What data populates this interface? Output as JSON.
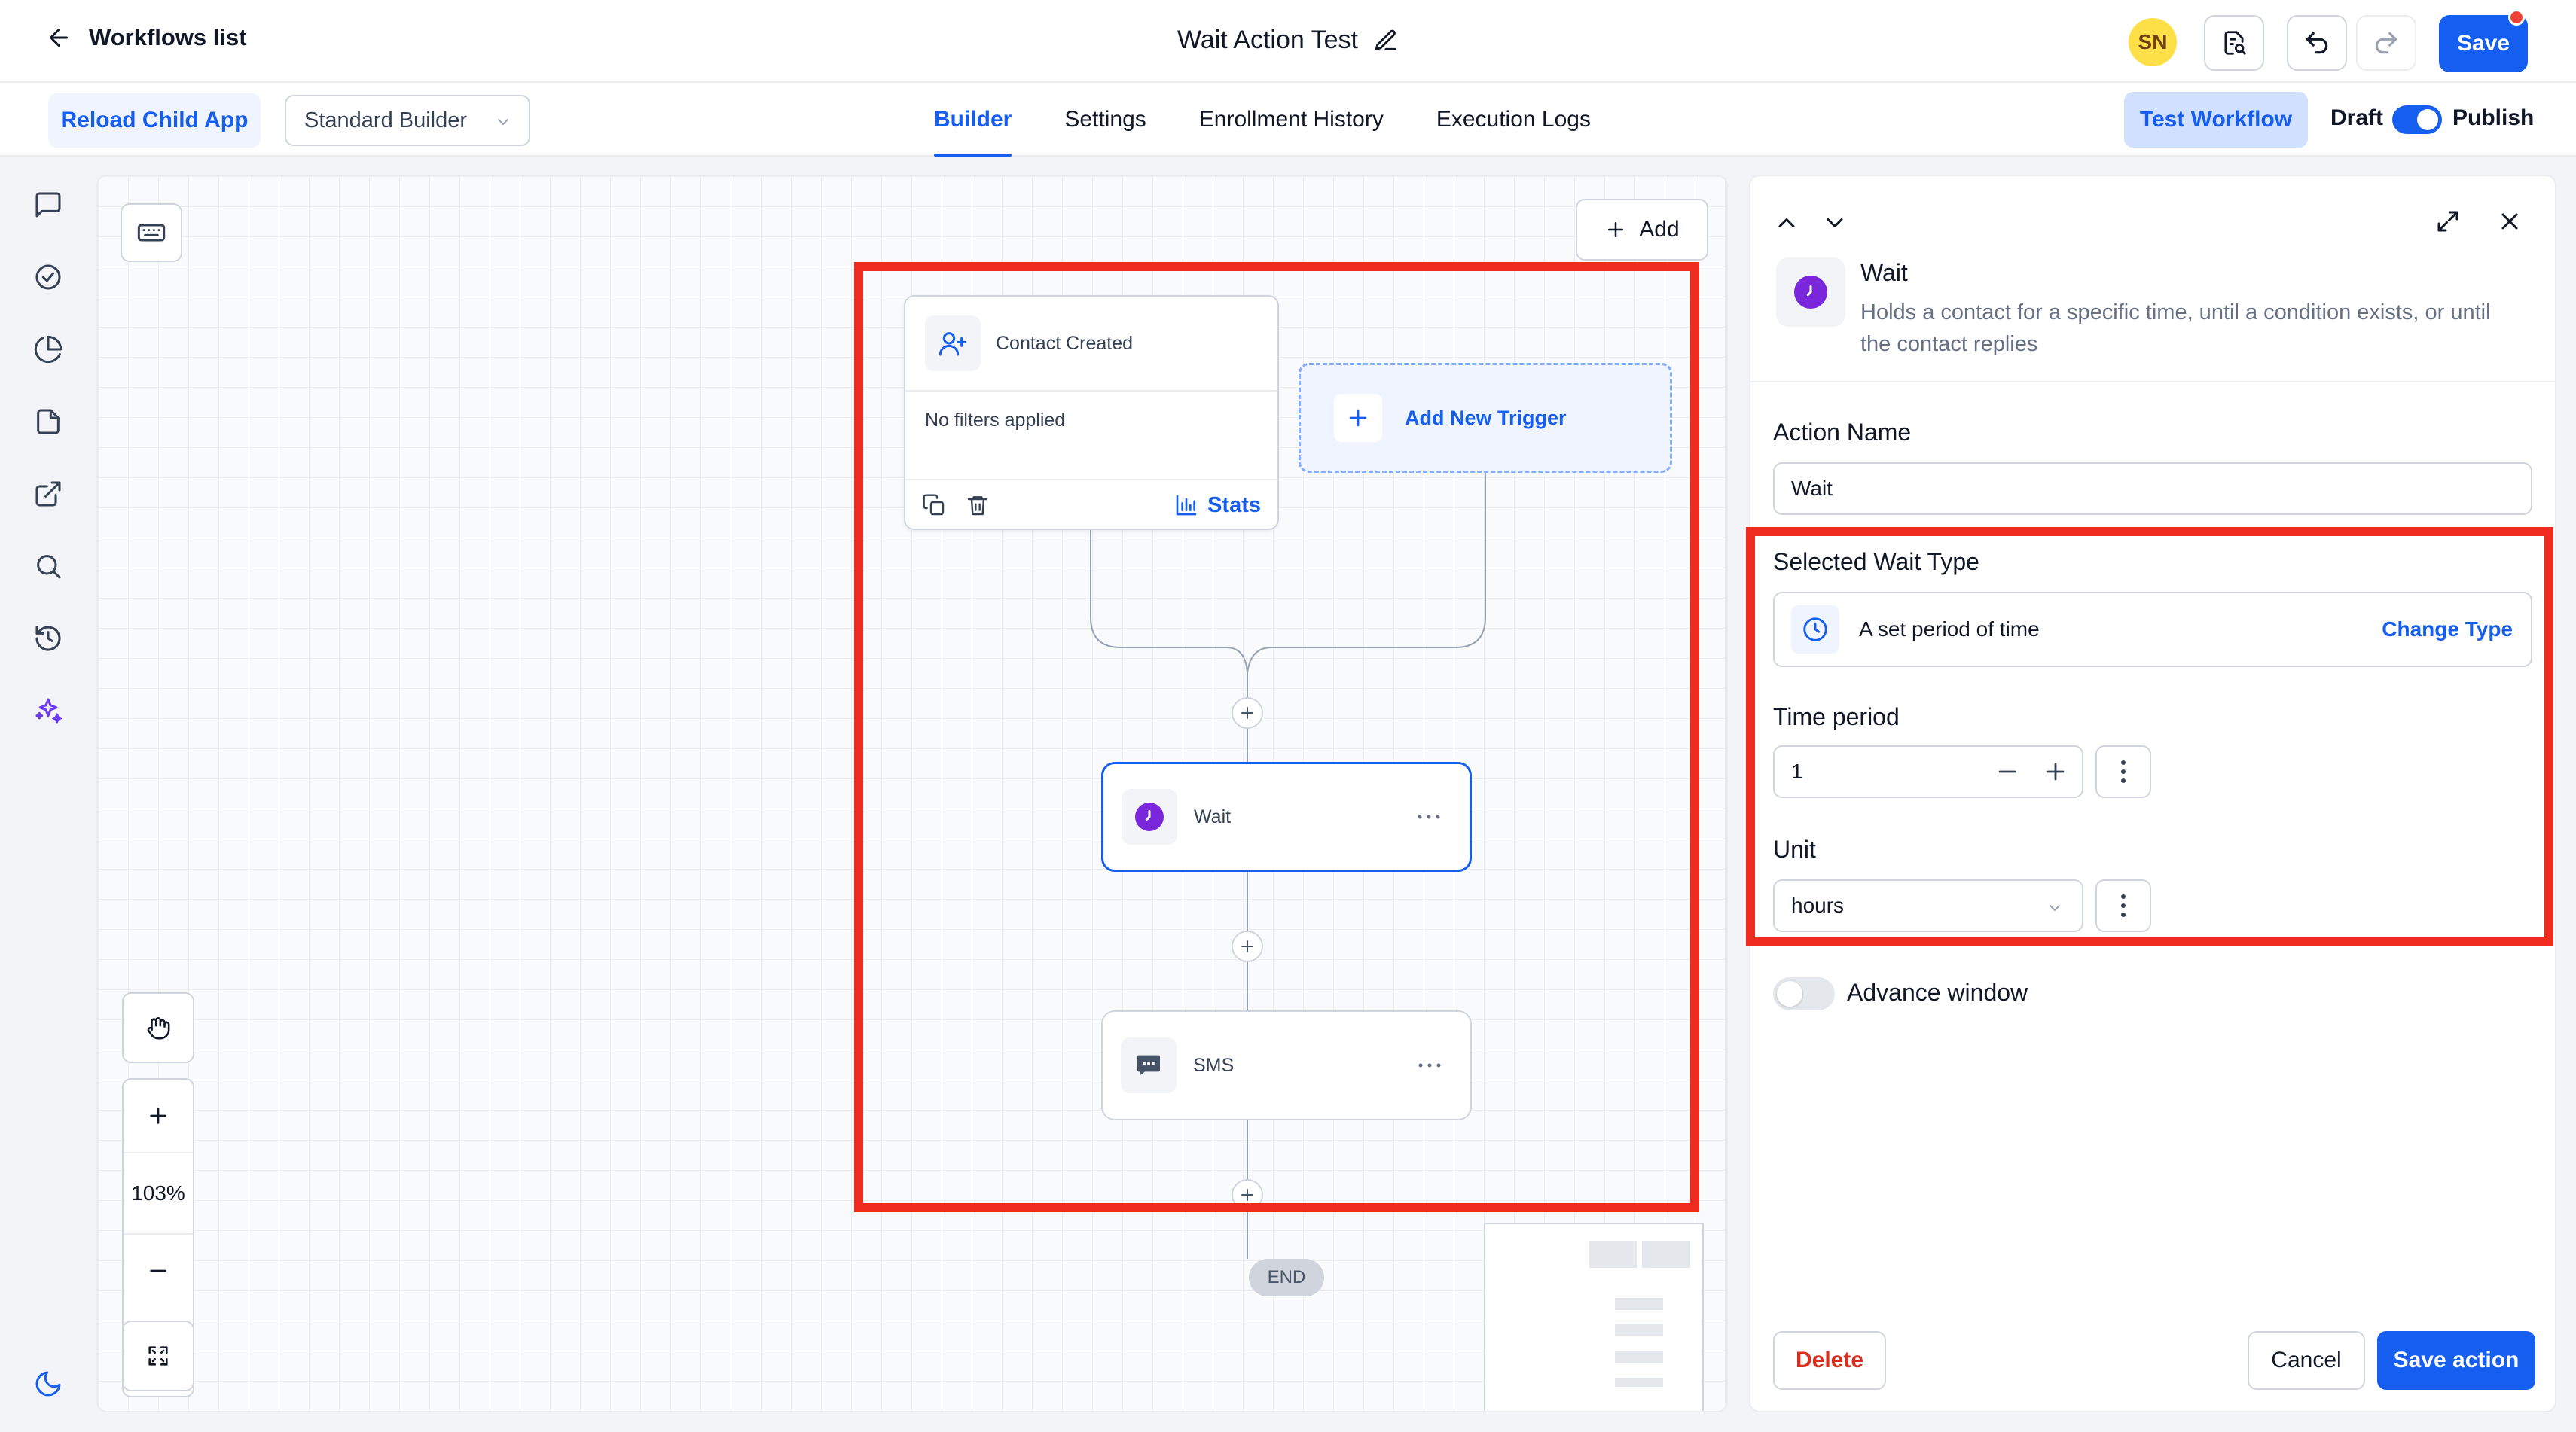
{
  "topbar": {
    "back_label": "Workflows list",
    "workflow_title": "Wait Action Test",
    "avatar_initials": "SN",
    "save_label": "Save",
    "icons": [
      "arrow-left-icon",
      "pencil-icon",
      "document-search-icon",
      "undo-icon",
      "redo-icon"
    ]
  },
  "subbar": {
    "reload_label": "Reload Child App",
    "builder_mode": "Standard Builder",
    "tabs": [
      {
        "label": "Builder",
        "active": true
      },
      {
        "label": "Settings",
        "active": false
      },
      {
        "label": "Enrollment History",
        "active": false
      },
      {
        "label": "Execution Logs",
        "active": false
      }
    ],
    "test_label": "Test Workflow",
    "draft_label": "Draft",
    "publish_label": "Publish",
    "publish_toggle_on": true
  },
  "rail": {
    "icons": [
      "chat-icon",
      "check-circle-icon",
      "pie-chart-icon",
      "file-icon",
      "external-link-icon",
      "search-icon",
      "history-icon",
      "sparkles-icon",
      "moon-icon"
    ]
  },
  "canvas": {
    "add_label": "Add",
    "trigger": {
      "name": "Contact Created",
      "filters": "No filters applied",
      "stats_label": "Stats"
    },
    "new_trigger_label": "Add New Trigger",
    "actions": [
      {
        "label": "Wait",
        "icon": "clock-icon",
        "selected": true
      },
      {
        "label": "SMS",
        "icon": "message-icon",
        "selected": false
      }
    ],
    "end_label": "END",
    "zoom_label": "103%",
    "highlight_color": "#ef2b1f"
  },
  "panel": {
    "action_type": "Wait",
    "description": "Holds a contact for a specific time, until a condition exists, or until the contact replies",
    "action_name_label": "Action Name",
    "action_name_value": "Wait",
    "wait_type_label": "Selected Wait Type",
    "wait_type_value": "A set period of time",
    "change_type_label": "Change Type",
    "time_period_label": "Time period",
    "time_period_value": "1",
    "unit_label": "Unit",
    "unit_value": "hours",
    "advance_window_label": "Advance window",
    "advance_window_on": false,
    "delete_label": "Delete",
    "cancel_label": "Cancel",
    "save_action_label": "Save action"
  },
  "colors": {
    "accent": "#155eef",
    "wait_purple": "#7a27db",
    "highlight": "#ef2b1f"
  }
}
